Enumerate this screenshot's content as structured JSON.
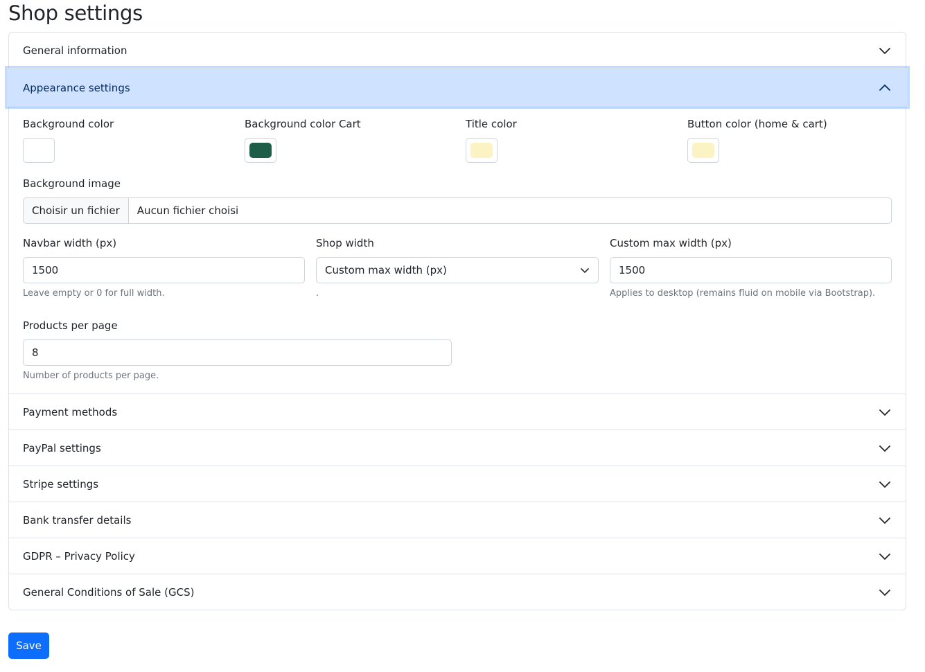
{
  "page": {
    "title": "Shop settings"
  },
  "sections": {
    "general": "General information",
    "appearance": "Appearance settings",
    "payment": "Payment methods",
    "paypal": "PayPal settings",
    "stripe": "Stripe settings",
    "bank": "Bank transfer details",
    "gdpr": "GDPR – Privacy Policy",
    "gcs": "General Conditions of Sale (GCS)"
  },
  "appearance": {
    "colors": [
      {
        "label": "Background color",
        "value": "#ffffff"
      },
      {
        "label": "Background color Cart",
        "value": "#1e5e48"
      },
      {
        "label": "Title color",
        "value": "#fbf3c3"
      },
      {
        "label": "Button color (home & cart)",
        "value": "#fbf3c3"
      }
    ],
    "background_image": {
      "label": "Background image",
      "button": "Choisir un fichier",
      "status": "Aucun fichier choisi"
    },
    "navbar_width": {
      "label": "Navbar width (px)",
      "value": "1500",
      "help": "Leave empty or 0 for full width."
    },
    "shop_width": {
      "label": "Shop width",
      "selected": "Custom max width (px)",
      "help": "."
    },
    "custom_max_width": {
      "label": "Custom max width (px)",
      "value": "1500",
      "help": "Applies to desktop (remains fluid on mobile via Bootstrap)."
    },
    "products_per_page": {
      "label": "Products per page",
      "value": "8",
      "help": "Number of products per page."
    }
  },
  "actions": {
    "save": "Save"
  },
  "icons": {
    "collapsed": "chevron-down-icon",
    "expanded": "chevron-up-icon"
  },
  "theme": {
    "accent": "#0d6efd",
    "open_header_bg": "#cfe2ff"
  }
}
